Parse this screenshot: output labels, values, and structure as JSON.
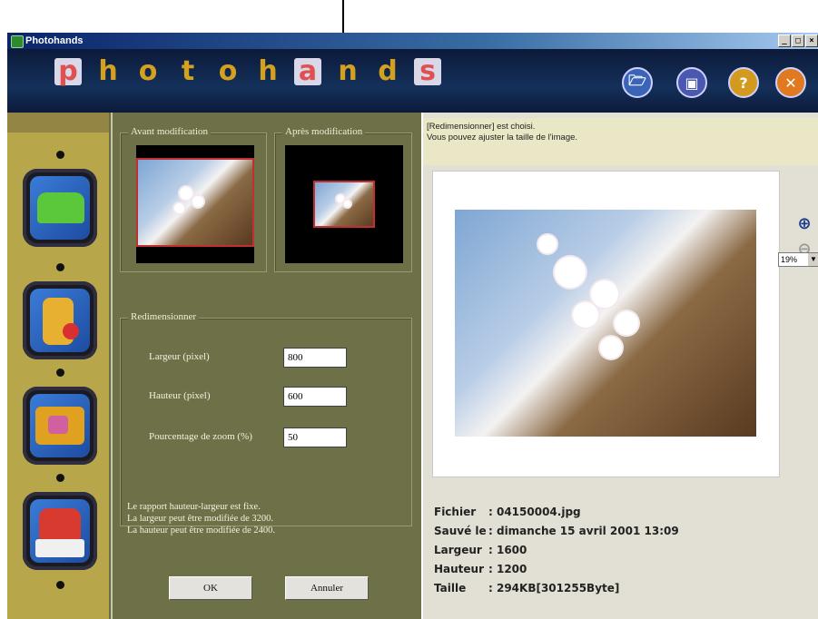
{
  "window": {
    "title": "Photohands",
    "controls": [
      "_",
      "□",
      "×"
    ]
  },
  "banner": {
    "logo_letters": [
      "p",
      "h",
      "o",
      "t",
      "o",
      "h",
      "a",
      "n",
      "d",
      "s"
    ],
    "toolbar": [
      {
        "name": "open-folder-icon",
        "color": "#3a64b8",
        "glyph": "🗁"
      },
      {
        "name": "save-icon",
        "color": "#4a58b0",
        "glyph": "▣"
      },
      {
        "name": "help-icon",
        "color": "#d49a20",
        "glyph": "?"
      },
      {
        "name": "close-icon",
        "color": "#e07a20",
        "glyph": "✕"
      }
    ]
  },
  "panel": {
    "before_label": "Avant modification",
    "after_label": "Après modification",
    "resize_group_label": "Redimensionner",
    "fields": {
      "width_label": "Largeur (pixel)",
      "width_value": "800",
      "height_label": "Hauteur (pixel)",
      "height_value": "600",
      "zoom_label": "Pourcentage de zoom (%)",
      "zoom_value": "50"
    },
    "info_lines": [
      "Le rapport hauteur-largeur est fixe.",
      "La largeur peut être modifiée de 3200.",
      "La hauteur peut être modifiée de 2400."
    ],
    "ok_label": "OK",
    "cancel_label": "Annuler"
  },
  "right": {
    "message_line1": "[Redimensionner] est choisi.",
    "message_line2": "Vous pouvez ajuster la taille de l'image.",
    "zoom_select_value": "19%",
    "metadata": [
      {
        "key": "Fichier",
        "value": ": 04150004.jpg"
      },
      {
        "key": "Sauvé le",
        "value": ": dimanche 15 avril 2001 13:09"
      },
      {
        "key": "Largeur",
        "value": ": 1600"
      },
      {
        "key": "Hauteur",
        "value": ": 1200"
      },
      {
        "key": "Taille",
        "value": ": 294KB[301255Byte]"
      }
    ]
  },
  "colors": {
    "panel_bg": "#6e7148",
    "sidebar_bg": "#b7a64a",
    "banner_bg": "#14305a",
    "message_bg": "#e9e7c6"
  }
}
